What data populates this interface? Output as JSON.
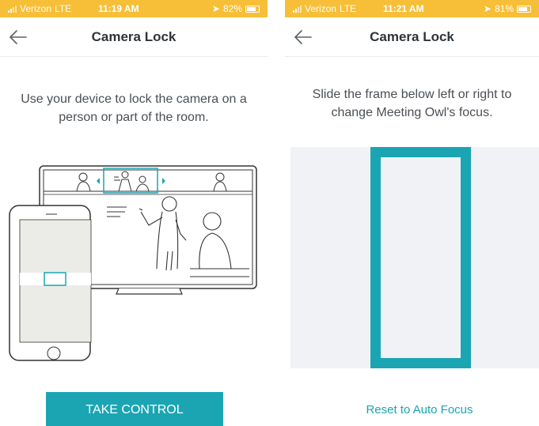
{
  "colors": {
    "status_bar": "#f7bf38",
    "accent": "#1ba5b3",
    "frame_bg": "#f0f2f6",
    "title_text": "#2f3438"
  },
  "left_screen": {
    "status_bar": {
      "carrier": "Verizon",
      "network": "LTE",
      "time": "11:19 AM",
      "battery": "82%",
      "battery_level": 0.82
    },
    "nav": {
      "title": "Camera Lock",
      "back_icon": "arrow-left-icon"
    },
    "instruction": "Use your device to lock the camera on a person or part of the room.",
    "primary_button": "TAKE CONTROL"
  },
  "right_screen": {
    "status_bar": {
      "carrier": "Verizon",
      "network": "LTE",
      "time": "11:21 AM",
      "battery": "81%",
      "battery_level": 0.81
    },
    "nav": {
      "title": "Camera Lock",
      "back_icon": "arrow-left-icon"
    },
    "instruction": "Slide the frame below left or right to change Meeting Owl's focus.",
    "link_button": "Reset to Auto Focus"
  }
}
